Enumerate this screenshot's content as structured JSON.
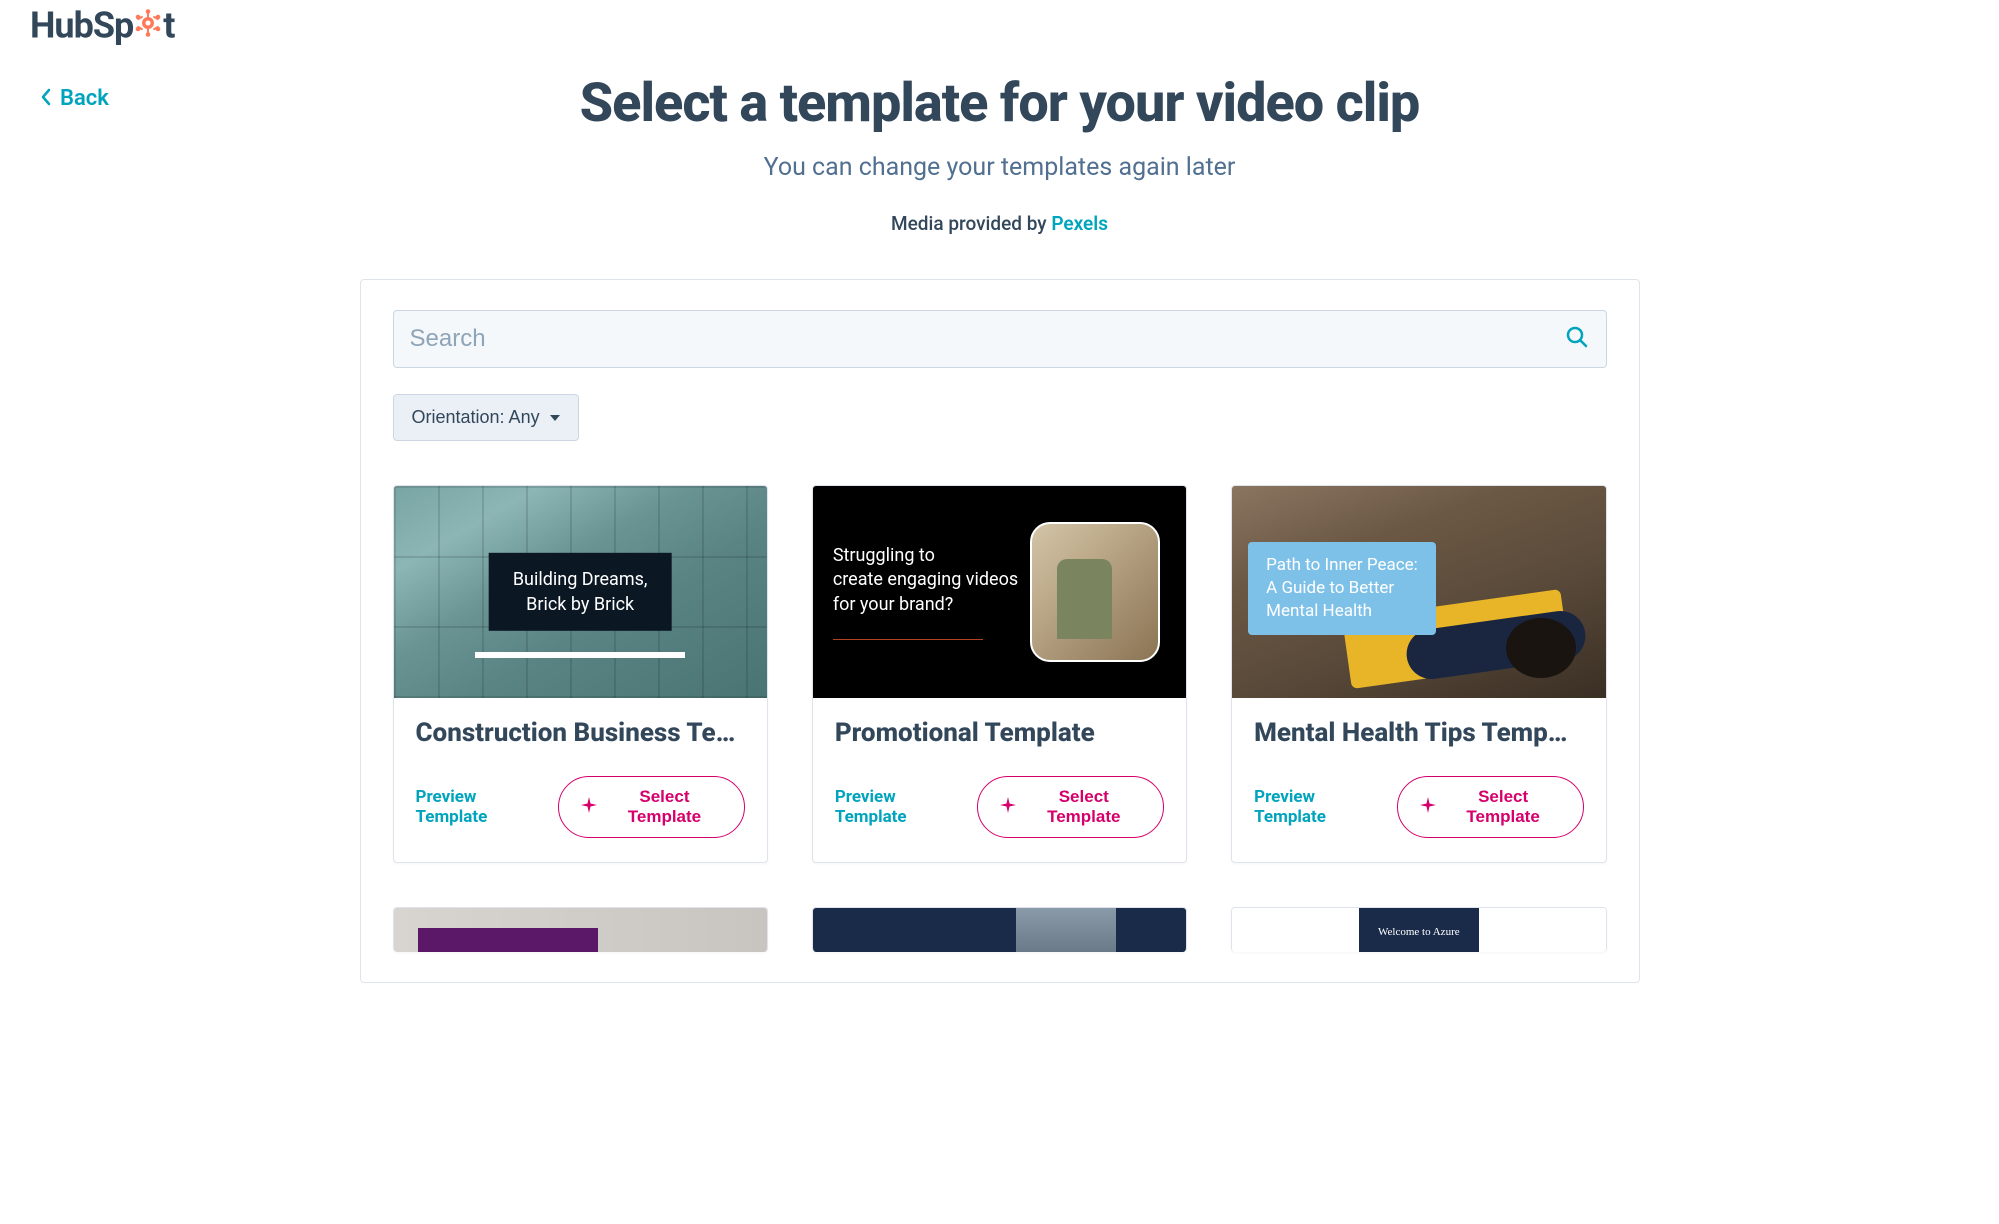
{
  "brand": "HubSpot",
  "nav": {
    "back_label": "Back"
  },
  "page": {
    "title": "Select a template for your video clip",
    "subtitle": "You can change your templates again later",
    "media_prefix": "Media provided by ",
    "media_provider": "Pexels"
  },
  "search": {
    "placeholder": "Search"
  },
  "filter": {
    "orientation_label": "Orientation: Any"
  },
  "actions": {
    "preview": "Preview Template",
    "select": "Select Template"
  },
  "templates": [
    {
      "title": "Construction Business Te…",
      "thumb_caption": "Building Dreams,\nBrick by Brick"
    },
    {
      "title": "Promotional Template",
      "thumb_caption": "Struggling to\ncreate engaging videos\nfor your brand?"
    },
    {
      "title": "Mental Health Tips Temp…",
      "thumb_caption": "Path to Inner Peace:\nA Guide to Better\nMental Health"
    }
  ],
  "row2_caption": "Welcome to Azure"
}
